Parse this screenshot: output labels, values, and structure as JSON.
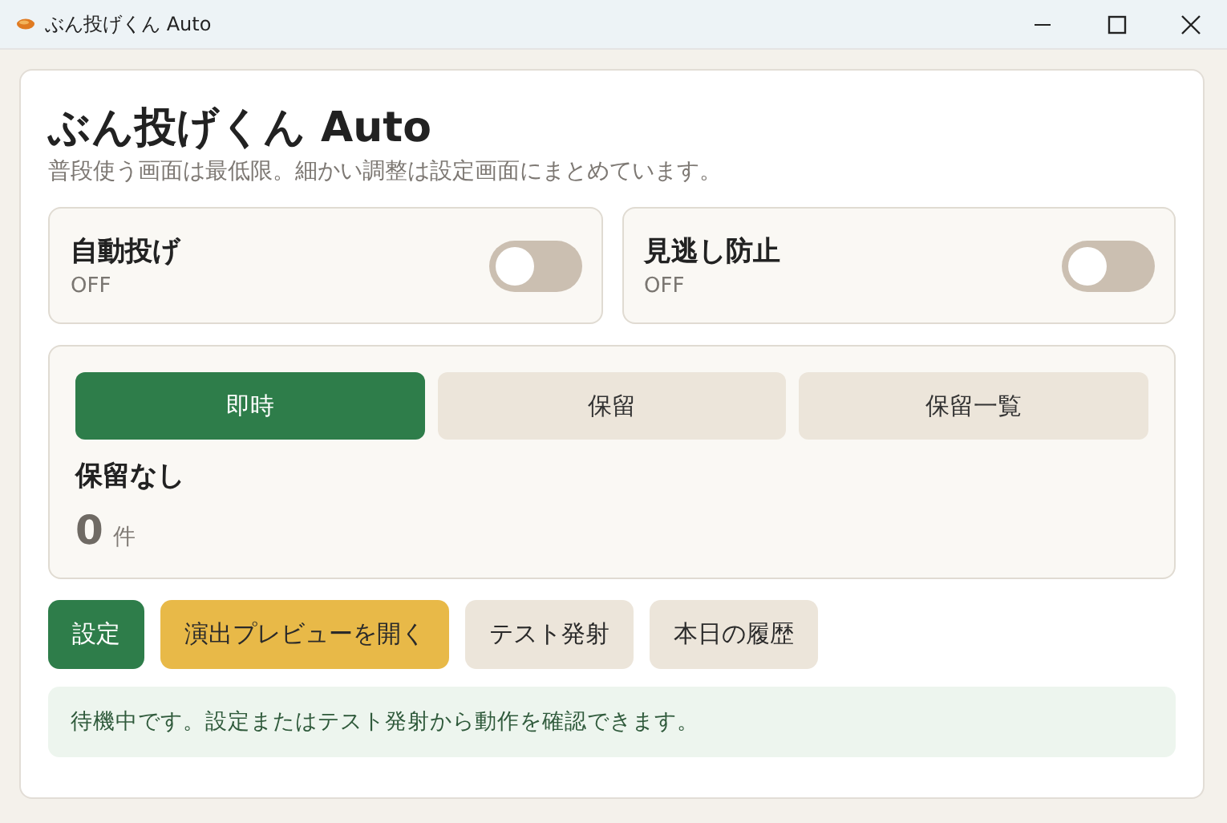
{
  "window": {
    "title": "ぶん投げくん Auto"
  },
  "header": {
    "title": "ぶん投げくん Auto",
    "subtitle": "普段使う画面は最低限。細かい調整は設定画面にまとめています。"
  },
  "toggles": [
    {
      "label": "自動投げ",
      "state_text": "OFF",
      "on": false
    },
    {
      "label": "見逃し防止",
      "state_text": "OFF",
      "on": false
    }
  ],
  "modes": {
    "tabs": [
      {
        "label": "即時",
        "selected": true
      },
      {
        "label": "保留",
        "selected": false
      },
      {
        "label": "保留一覧",
        "selected": false
      }
    ],
    "pending_title": "保留なし",
    "count": "0",
    "count_unit": "件"
  },
  "buttons": [
    {
      "label": "設定",
      "kind": "primary"
    },
    {
      "label": "演出プレビューを開く",
      "kind": "accent"
    },
    {
      "label": "テスト発射",
      "kind": "secondary"
    },
    {
      "label": "本日の履歴",
      "kind": "secondary"
    }
  ],
  "status": "待機中です。設定またはテスト発射から動作を確認できます。"
}
